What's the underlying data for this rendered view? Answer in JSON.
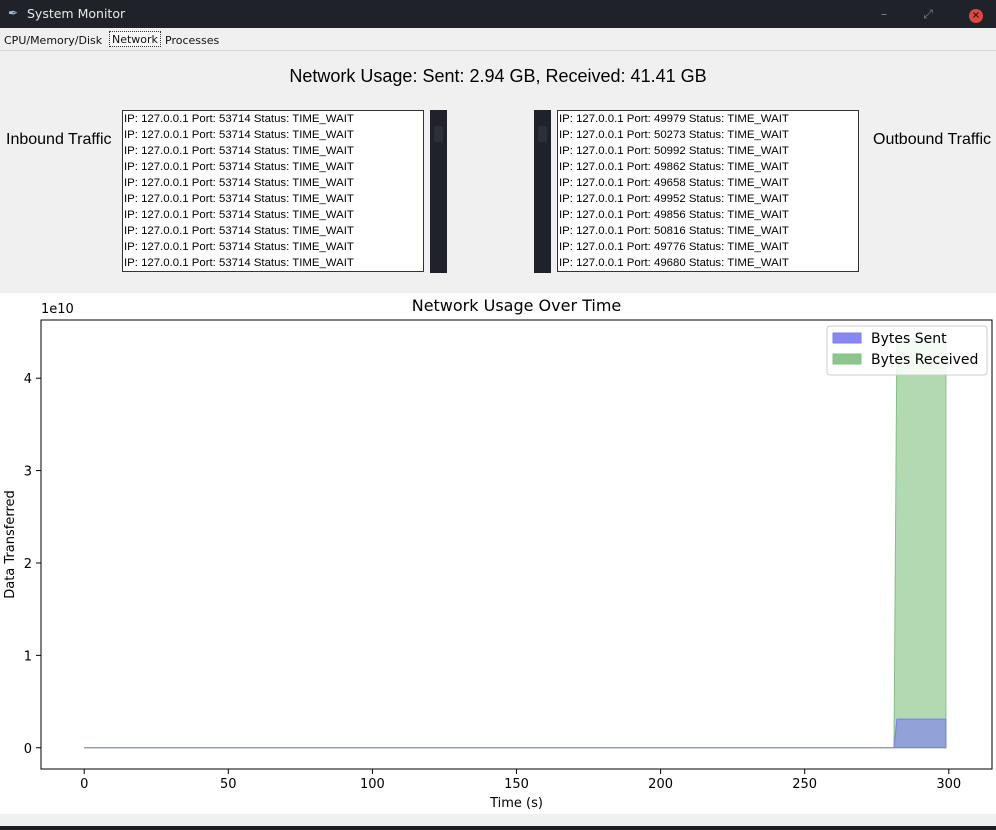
{
  "window": {
    "title": "System Monitor",
    "icon": "feather-icon",
    "min_glyph": "–",
    "max_glyph": "⤢",
    "close_glyph": "×"
  },
  "tabs": [
    {
      "label": "CPU/Memory/Disk",
      "active": false
    },
    {
      "label": "Network",
      "active": true
    },
    {
      "label": "Processes",
      "active": false
    }
  ],
  "network": {
    "usage_title": "Network Usage: Sent: 2.94 GB, Received: 41.41 GB",
    "inbound_label": "Inbound Traffic",
    "outbound_label": "Outbound Traffic",
    "inbound_connections": [
      "IP: 127.0.0.1 Port: 53714 Status: TIME_WAIT",
      "IP: 127.0.0.1 Port: 53714 Status: TIME_WAIT",
      "IP: 127.0.0.1 Port: 53714 Status: TIME_WAIT",
      "IP: 127.0.0.1 Port: 53714 Status: TIME_WAIT",
      "IP: 127.0.0.1 Port: 53714 Status: TIME_WAIT",
      "IP: 127.0.0.1 Port: 53714 Status: TIME_WAIT",
      "IP: 127.0.0.1 Port: 53714 Status: TIME_WAIT",
      "IP: 127.0.0.1 Port: 53714 Status: TIME_WAIT",
      "IP: 127.0.0.1 Port: 53714 Status: TIME_WAIT",
      "IP: 127.0.0.1 Port: 53714 Status: TIME_WAIT"
    ],
    "outbound_connections": [
      "IP: 127.0.0.1 Port: 49979 Status: TIME_WAIT",
      "IP: 127.0.0.1 Port: 50273 Status: TIME_WAIT",
      "IP: 127.0.0.1 Port: 50992 Status: TIME_WAIT",
      "IP: 127.0.0.1 Port: 49862 Status: TIME_WAIT",
      "IP: 127.0.0.1 Port: 49658 Status: TIME_WAIT",
      "IP: 127.0.0.1 Port: 49952 Status: TIME_WAIT",
      "IP: 127.0.0.1 Port: 49856 Status: TIME_WAIT",
      "IP: 127.0.0.1 Port: 50816 Status: TIME_WAIT",
      "IP: 127.0.0.1 Port: 49776 Status: TIME_WAIT",
      "IP: 127.0.0.1 Port: 49680 Status: TIME_WAIT"
    ]
  },
  "chart_data": {
    "type": "area",
    "title": "Network Usage Over Time",
    "xlabel": "Time (s)",
    "ylabel": "Data Transferred",
    "y_offset_label": "1e10",
    "xlim": [
      -15,
      315
    ],
    "ylim": [
      -0.23,
      4.63
    ],
    "x_ticks": [
      0,
      50,
      100,
      150,
      200,
      250,
      300
    ],
    "y_ticks": [
      0,
      1,
      2,
      3,
      4
    ],
    "grid": false,
    "legend_position": "top-right",
    "series": [
      {
        "name": "Bytes Sent",
        "color": "#7b7bf0",
        "x": [
          0,
          281,
          282,
          299
        ],
        "y": [
          0,
          0,
          0.31,
          0.31
        ]
      },
      {
        "name": "Bytes Received",
        "color": "#80c080",
        "x": [
          0,
          281,
          282,
          299
        ],
        "y": [
          0,
          0,
          4.42,
          4.42
        ]
      }
    ]
  }
}
